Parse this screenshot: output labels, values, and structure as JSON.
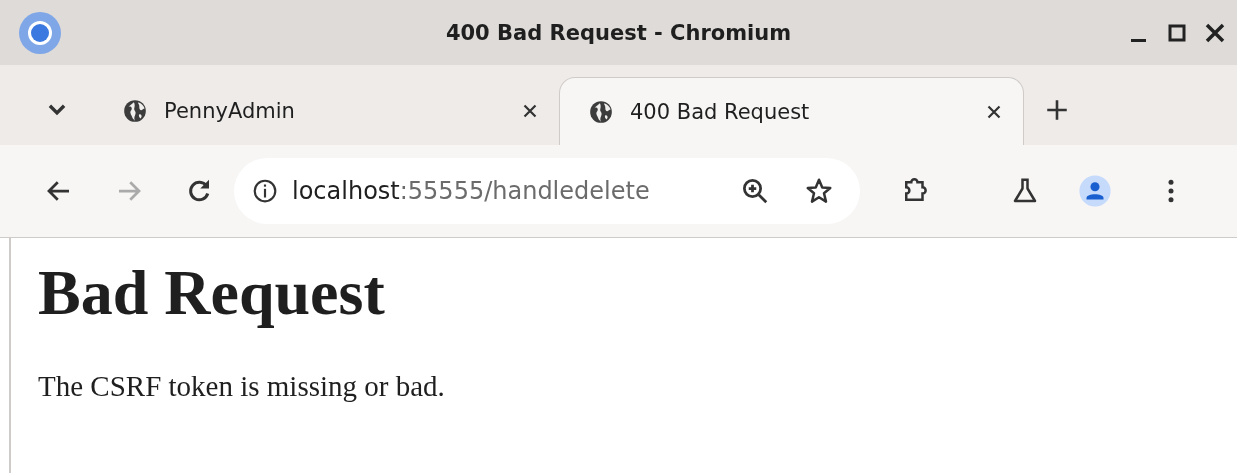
{
  "window": {
    "title": "400 Bad Request - Chromium"
  },
  "tabs": [
    {
      "title": "PennyAdmin",
      "selected": false
    },
    {
      "title": "400 Bad Request",
      "selected": true
    }
  ],
  "address_bar": {
    "host": "localhost",
    "path": ":55555/handledelete"
  },
  "page": {
    "heading": "Bad Request",
    "message": "The CSRF token is missing or bad."
  }
}
